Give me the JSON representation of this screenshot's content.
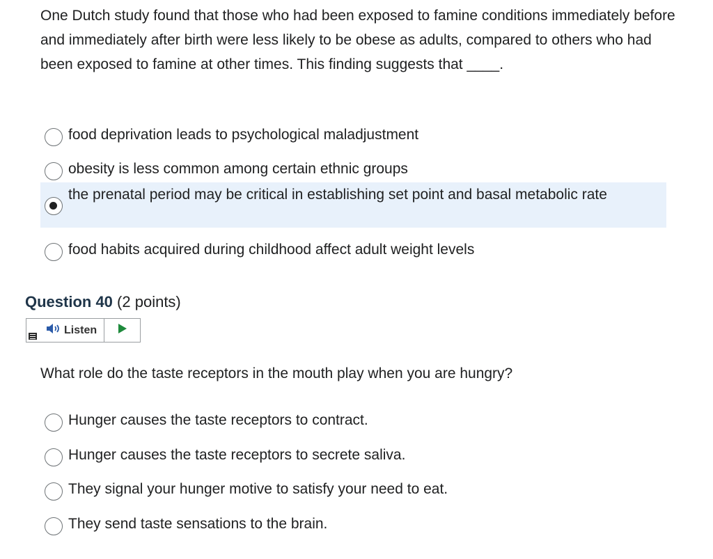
{
  "question39": {
    "text": "One Dutch study found that those who had been exposed to famine conditions immediately before and immediately after birth were less likely to be obese as adults, compared to others who had been exposed to famine at other times. This finding suggests that ____.",
    "options": [
      {
        "label": "food deprivation leads to psychological maladjustment",
        "selected": false
      },
      {
        "label": "obesity is less common among certain ethnic groups",
        "selected": false
      },
      {
        "label": "the prenatal period may be critical in establishing set point and basal metabolic rate",
        "selected": true
      },
      {
        "label": "food habits acquired during childhood affect adult weight levels",
        "selected": false
      }
    ]
  },
  "question40": {
    "number_label": "Question 40",
    "points_label": "(2 points)",
    "listen_label": "Listen",
    "text": "What role do the taste receptors in the mouth play when you are hungry?",
    "options": [
      {
        "label": "Hunger causes the taste receptors to contract.",
        "selected": false
      },
      {
        "label": "Hunger causes the taste receptors to secrete saliva.",
        "selected": false
      },
      {
        "label": "They signal your hunger motive to satisfy your need to eat.",
        "selected": false
      },
      {
        "label": "They send taste sensations to the brain.",
        "selected": false
      }
    ]
  },
  "icons": {
    "speaker": "speaker-icon",
    "play": "play-icon",
    "menu": "menu-icon"
  },
  "colors": {
    "selected_background": "#e8f1fb",
    "play_green": "#1e8a3c",
    "heading_color": "#1f3549"
  }
}
